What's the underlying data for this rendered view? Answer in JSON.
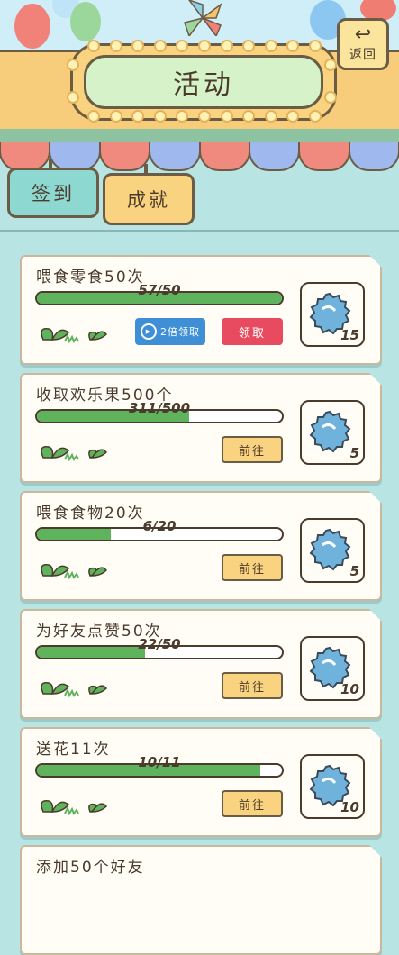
{
  "header": {
    "title": "活动",
    "back_label": "返回"
  },
  "tabs": [
    {
      "label": "签到",
      "selected": false
    },
    {
      "label": "成就",
      "selected": true
    }
  ],
  "colors": {
    "progress": "#5fb35d",
    "claim": "#e84b5f",
    "double_claim": "#3e8fd6",
    "go": "#f9d37f"
  },
  "tasks": [
    {
      "title": "喂食零食50次",
      "progress_text": "57/50",
      "progress": 1.0,
      "reward_icon": "bottle-cap-icon",
      "reward_qty": "15",
      "buttons": {
        "double": "2倍领取",
        "claim": "领取"
      }
    },
    {
      "title": "收取欢乐果500个",
      "progress_text": "311/500",
      "progress": 0.62,
      "reward_icon": "bottle-cap-icon",
      "reward_qty": "5",
      "buttons": {
        "go": "前往"
      }
    },
    {
      "title": "喂食食物20次",
      "progress_text": "6/20",
      "progress": 0.3,
      "reward_icon": "bottle-cap-icon",
      "reward_qty": "5",
      "buttons": {
        "go": "前往"
      }
    },
    {
      "title": "为好友点赞50次",
      "progress_text": "22/50",
      "progress": 0.44,
      "reward_icon": "bottle-cap-icon",
      "reward_qty": "10",
      "buttons": {
        "go": "前往"
      }
    },
    {
      "title": "送花11次",
      "progress_text": "10/11",
      "progress": 0.91,
      "reward_icon": "bottle-cap-icon",
      "reward_qty": "10",
      "buttons": {
        "go": "前往"
      }
    },
    {
      "title": "添加50个好友"
    }
  ]
}
